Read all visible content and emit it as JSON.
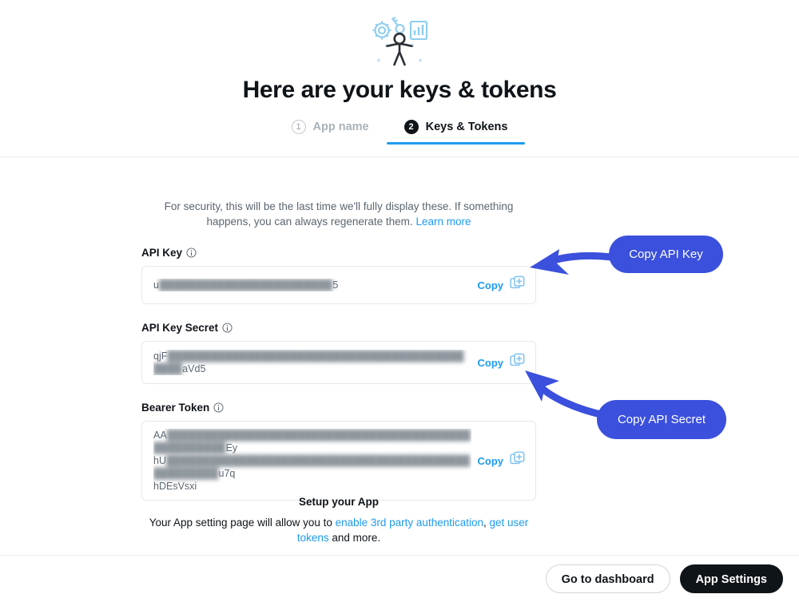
{
  "header": {
    "title": "Here are your keys & tokens",
    "hero_icon": "person-gear-key-chart-illustration",
    "steps": [
      {
        "number": "1",
        "label": "App name",
        "state": "inactive"
      },
      {
        "number": "2",
        "label": "Keys & Tokens",
        "state": "active"
      }
    ]
  },
  "main": {
    "intro_text": "For security, this will be the last time we'll fully display these. If something happens, you can always regenerate them. ",
    "intro_link": "Learn more",
    "fields": [
      {
        "label": "API Key",
        "info_icon": "info-circle-icon",
        "value_prefix": "u",
        "value_masked": "████████████████████████",
        "value_suffix": "5",
        "copy_label": "Copy",
        "copy_icon": "copy-icon"
      },
      {
        "label": "API Key Secret",
        "info_icon": "info-circle-icon",
        "value_prefix": "qjF",
        "value_masked": "█████████████████████████████████████████████",
        "value_suffix": "aVd5",
        "copy_label": "Copy",
        "copy_icon": "copy-icon"
      }
    ],
    "bearer": {
      "label": "Bearer Token",
      "info_icon": "info-circle-icon",
      "line1_prefix": "AA",
      "line1_masked": "████████████████████████████████████████████████████",
      "line1_suffix": "Ey",
      "line2_prefix": "hU",
      "line2_masked": "███████████████████████████████████████████████████",
      "line2_suffix": "u7q",
      "line3": "hDEsVsxi",
      "copy_label": "Copy",
      "copy_icon": "copy-icon"
    }
  },
  "setup": {
    "title": "Setup your App",
    "desc_part1": "Your App setting page will allow you to ",
    "link1": "enable 3rd party authentication",
    "desc_part2": ", ",
    "link2": "get user tokens",
    "desc_part3": " and more."
  },
  "bottom_bar": {
    "dashboard_button": "Go to dashboard",
    "app_settings_button": "App Settings"
  },
  "annotations": [
    {
      "id": "copy-api-key",
      "label": "Copy API Key",
      "color": "#3b50dc"
    },
    {
      "id": "copy-api-secret",
      "label": "Copy API Secret",
      "color": "#3b50dc"
    }
  ],
  "colors": {
    "accent_blue": "#1d9bf0",
    "annotation_blue": "#3b50dc",
    "text_dark": "#0f1419",
    "text_muted": "#5b6671",
    "border": "#e6e8ea"
  }
}
